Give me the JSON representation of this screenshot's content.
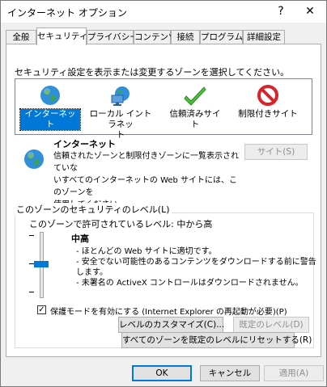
{
  "window": {
    "title": "インターネット オプション",
    "help_label": "?",
    "close_label": "✕"
  },
  "tabs": [
    {
      "label": "全般"
    },
    {
      "label": "セキュリティ"
    },
    {
      "label": "プライバシー"
    },
    {
      "label": "コンテンツ"
    },
    {
      "label": "接続"
    },
    {
      "label": "プログラム"
    },
    {
      "label": "詳細設定"
    }
  ],
  "security": {
    "prompt": "セキュリティ設定を表示または変更するゾーンを選択してください。",
    "zones": [
      {
        "label": "インターネット",
        "icon": "globe-icon",
        "selected": true
      },
      {
        "label_line1": "ローカル イントラネッ",
        "label_line2": "ト",
        "icon": "network-computer-icon"
      },
      {
        "label": "信頼済みサイト",
        "icon": "green-check-icon"
      },
      {
        "label": "制限付きサイト",
        "icon": "red-no-icon"
      }
    ],
    "zone_title": "インターネット",
    "zone_desc_line1": "信頼されたゾーンと制限付きゾーンに一覧表示されていな",
    "zone_desc_line2": "いすべてのインターネットの Web サイトには、このゾーンを",
    "zone_desc_line3": "使用してください。",
    "sites_button": "サイト(S)",
    "level_group_title": "このゾーンのセキュリティのレベル(L)",
    "allowed_levels": "このゾーンで許可されているレベル: 中から高",
    "level_name": "中高",
    "level_bullets": [
      "- ほとんどの Web サイトに適切です。",
      "- 安全でない可能性のあるコンテンツをダウンロードする前に警告します。",
      "- 未署名の ActiveX コントロールはダウンロードされません。"
    ],
    "protected_mode_label": "保護モードを有効にする (Internet Explorer の再起動が必要)(P)",
    "protected_mode_checked": true,
    "custom_level_button": "レベルのカスタマイズ(C)...",
    "default_level_button": "既定のレベル(D)",
    "reset_all_button": "すべてのゾーンを既定のレベルにリセットする(R)"
  },
  "footer": {
    "ok": "OK",
    "cancel": "キャンセル",
    "apply": "適用(A)"
  },
  "colors": {
    "accent": "#0078d7"
  }
}
